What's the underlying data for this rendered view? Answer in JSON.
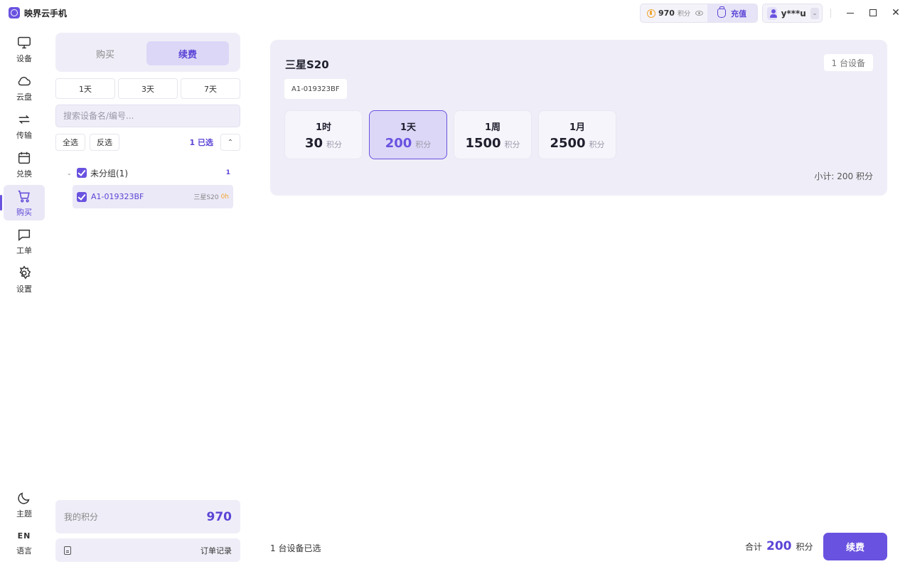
{
  "app": {
    "title": "映界云手机"
  },
  "titlebar": {
    "points_value": "970",
    "points_unit": "积分",
    "recharge_label": "充值",
    "username": "y***u"
  },
  "nav": {
    "items": [
      {
        "label": "设备",
        "icon": "monitor-icon"
      },
      {
        "label": "云盘",
        "icon": "cloud-icon"
      },
      {
        "label": "传输",
        "icon": "transfer-icon"
      },
      {
        "label": "兑换",
        "icon": "calendar-icon"
      },
      {
        "label": "购买",
        "icon": "cart-icon"
      },
      {
        "label": "工单",
        "icon": "message-icon"
      },
      {
        "label": "设置",
        "icon": "gear-icon"
      }
    ],
    "active": "购买",
    "theme_label": "主题",
    "language_glyph": "EN",
    "language_label": "语言"
  },
  "panel": {
    "tabs": [
      "购买",
      "续费"
    ],
    "active_tab": "续费",
    "day_options": [
      "1天",
      "3天",
      "7天"
    ],
    "search_placeholder": "搜索设备名/编号...",
    "select_all": "全选",
    "invert_select": "反选",
    "selected_count": "1 已选",
    "group": {
      "label": "未分组(1)",
      "count": "1"
    },
    "devices": [
      {
        "id": "A1-019323BF",
        "model": "三星S20",
        "time": "0h"
      }
    ],
    "my_points_label": "我的积分",
    "my_points_value": "970",
    "order_records": "订单记录"
  },
  "product": {
    "title": "三星S20",
    "device_count_badge": "1 台设备",
    "device_id": "A1-019323BF",
    "plans": [
      {
        "label": "1时",
        "price": "30",
        "unit": "积分",
        "selected": false
      },
      {
        "label": "1天",
        "price": "200",
        "unit": "积分",
        "selected": true
      },
      {
        "label": "1周",
        "price": "1500",
        "unit": "积分",
        "selected": false
      },
      {
        "label": "1月",
        "price": "2500",
        "unit": "积分",
        "selected": false
      }
    ],
    "subtotal": "小计: 200 积分"
  },
  "footer": {
    "selected_text": "1 台设备已选",
    "total_label": "合计",
    "total_value": "200",
    "total_unit": "积分",
    "renew_button": "续费"
  },
  "colors": {
    "accent": "#6a52e0",
    "accent_light": "#dcd7f7",
    "panel_bg": "#efeef8",
    "coin": "#f0a531"
  }
}
